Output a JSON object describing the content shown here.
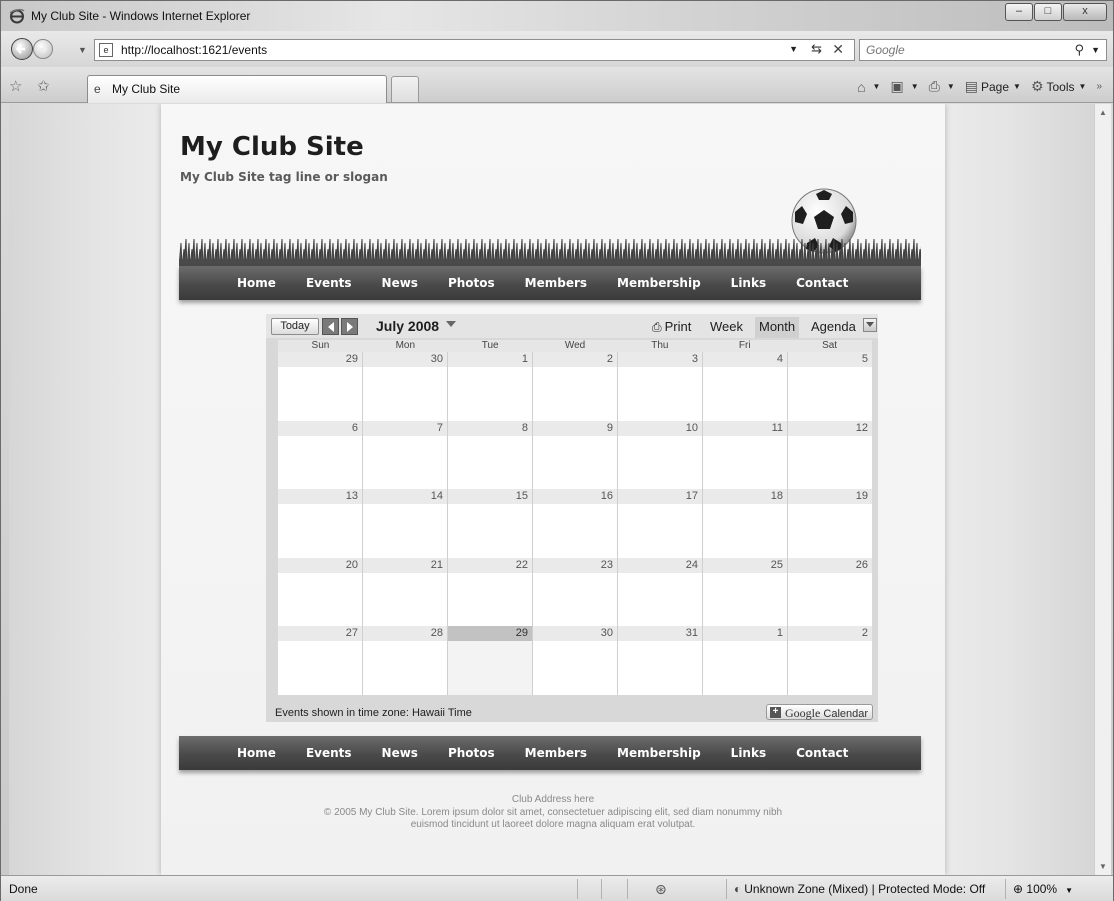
{
  "window": {
    "title": "My Club Site - Windows Internet Explorer",
    "controls": {
      "minimize": "‒",
      "maximize": "□",
      "close": "x"
    }
  },
  "address_bar": {
    "url": "http://localhost:1621/events",
    "search_placeholder": "Google"
  },
  "tab_bar": {
    "active_tab": "My Club Site",
    "commands": [
      "Page",
      "Tools"
    ]
  },
  "site": {
    "title": "My Club Site",
    "tagline": "My Club Site tag line or slogan",
    "nav": [
      "Home",
      "Events",
      "News",
      "Photos",
      "Members",
      "Membership",
      "Links",
      "Contact"
    ]
  },
  "calendar": {
    "today_label": "Today",
    "month_label": "July 2008",
    "print_label": "Print",
    "views": {
      "week": "Week",
      "month": "Month",
      "agenda": "Agenda"
    },
    "active_view": "Month",
    "weekdays": [
      "Sun",
      "Mon",
      "Tue",
      "Wed",
      "Thu",
      "Fri",
      "Sat"
    ],
    "weeks": [
      [
        "29",
        "30",
        "1",
        "2",
        "3",
        "4",
        "5"
      ],
      [
        "6",
        "7",
        "8",
        "9",
        "10",
        "11",
        "12"
      ],
      [
        "13",
        "14",
        "15",
        "16",
        "17",
        "18",
        "19"
      ],
      [
        "20",
        "21",
        "22",
        "23",
        "24",
        "25",
        "26"
      ],
      [
        "27",
        "28",
        "29",
        "30",
        "31",
        "1",
        "2"
      ]
    ],
    "today_date": "29",
    "timezone_text": "Events shown in time zone: Hawaii Time",
    "gcal_button": {
      "brand": "Google",
      "label": "Calendar"
    }
  },
  "footer": {
    "address": "Club Address here",
    "copyright_line1": "© 2005 My Club Site. Lorem ipsum dolor sit amet, consectetuer adipiscing elit, sed diam nonummy nibh",
    "copyright_line2": "euismod tincidunt ut laoreet dolore magna aliquam erat volutpat."
  },
  "status_bar": {
    "status": "Done",
    "zone": "Unknown Zone (Mixed) | Protected Mode: Off",
    "zoom": "100%"
  }
}
